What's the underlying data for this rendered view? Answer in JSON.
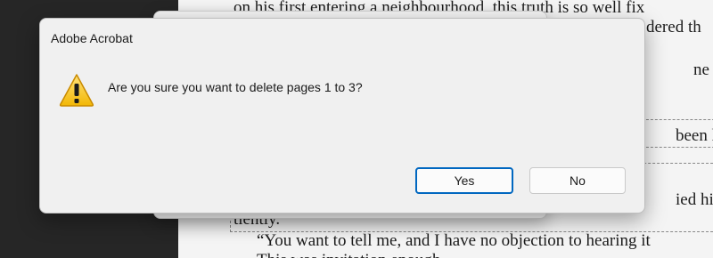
{
  "document": {
    "lines": [
      "on his first entering a neighbourhood, this truth is so well fix",
      "dered th",
      "ne day, “",
      "been here",
      "ied his w",
      "tiently.",
      "“You want to tell me, and I have no objection to hearing it",
      "This was invitation enough."
    ]
  },
  "dialog": {
    "title": "Adobe Acrobat",
    "icon": "warning-icon",
    "message": "Are you sure you want to delete pages 1 to 3?",
    "yes_label": "Yes",
    "no_label": "No"
  },
  "colors": {
    "accent": "#0067c0",
    "warning_yellow": "#f7c326"
  }
}
